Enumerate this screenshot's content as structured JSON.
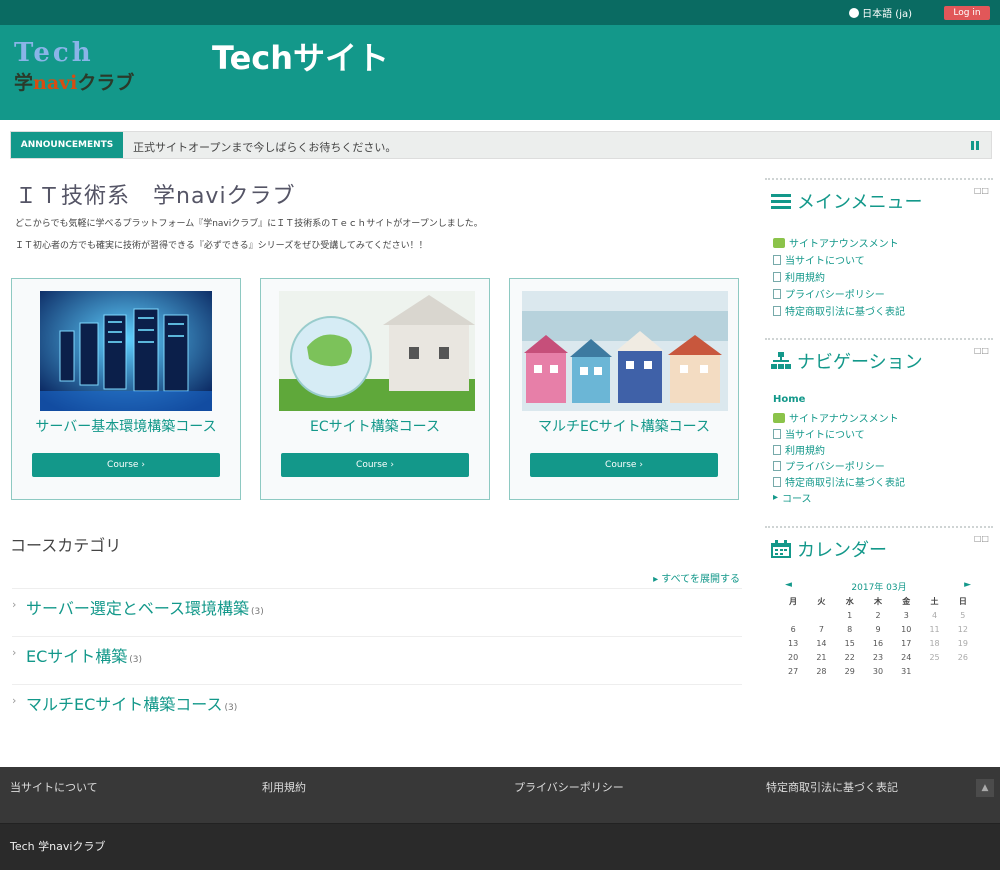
{
  "topbar": {
    "language": "日本語 (ja)",
    "login": "Log in"
  },
  "logo": {
    "line1": "Tech",
    "line2_kanji": "学",
    "line2_navi": "navi",
    "line2_kana": "クラブ"
  },
  "site_title": "Techサイト",
  "announcement": {
    "label": "ANNOUNCEMENTS",
    "text": "正式サイトオープンまで今しばらくお待ちください。"
  },
  "main": {
    "heading": "ＩＴ技術系　学naviクラブ",
    "intro1": "どこからでも気軽に学べるプラットフォーム『学naviクラブ』にＩＴ技術系のＴｅｃｈサイトがオープンしました。",
    "intro2": "ＩＴ初心者の方でも確実に技術が習得できる『必ずできる』シリーズをぜひ受講してみてください！！",
    "courses": [
      {
        "title": "サーバー基本環境構築コース",
        "button": "Course ›"
      },
      {
        "title": "ECサイト構築コース",
        "button": "Course ›"
      },
      {
        "title": "マルチECサイト構築コース",
        "button": "Course ›"
      }
    ]
  },
  "categories": {
    "heading": "コースカテゴリ",
    "expand_all": "すべてを展開する",
    "items": [
      {
        "name": "サーバー選定とベース環境構築",
        "count": "(3)"
      },
      {
        "name": "ECサイト構築",
        "count": "(3)"
      },
      {
        "name": "マルチECサイト構築コース",
        "count": "(3)"
      }
    ]
  },
  "sidebar": {
    "menu_title": "メインメニュー",
    "menu_items": [
      "サイトアナウンスメント",
      "当サイトについて",
      "利用規約",
      "プライバシーポリシー",
      "特定商取引法に基づく表記"
    ],
    "nav_title": "ナビゲーション",
    "nav_home": "Home",
    "nav_items": [
      "サイトアナウンスメント",
      "当サイトについて",
      "利用規約",
      "プライバシーポリシー",
      "特定商取引法に基づく表記"
    ],
    "nav_course": "コース",
    "cal_title": "カレンダー",
    "hide_label": "□□",
    "cal_month": "2017年 03月",
    "cal_prev": "◄",
    "cal_next": "►",
    "cal_weekdays": [
      "月",
      "火",
      "水",
      "木",
      "金",
      "土",
      "日"
    ],
    "cal_weeks": [
      [
        "",
        "",
        "1",
        "2",
        "3",
        "4",
        "5"
      ],
      [
        "6",
        "7",
        "8",
        "9",
        "10",
        "11",
        "12"
      ],
      [
        "13",
        "14",
        "15",
        "16",
        "17",
        "18",
        "19"
      ],
      [
        "20",
        "21",
        "22",
        "23",
        "24",
        "25",
        "26"
      ],
      [
        "27",
        "28",
        "29",
        "30",
        "31",
        "",
        ""
      ]
    ]
  },
  "footer": {
    "links": [
      "当サイトについて",
      "利用規約",
      "プライバシーポリシー",
      "特定商取引法に基づく表記"
    ],
    "copyright": "Tech 学naviクラブ"
  }
}
